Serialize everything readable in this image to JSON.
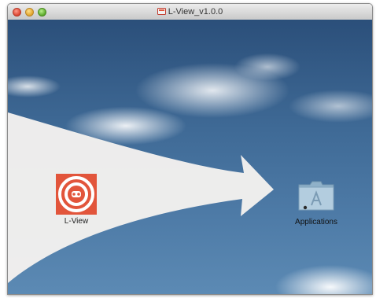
{
  "window": {
    "title": "L-View_v1.0.0"
  },
  "icons": {
    "title_icon": "disk-image-icon",
    "app_icon": "l-view-app-icon",
    "folder_icon": "applications-folder-icon",
    "arrow": "drag-arrow"
  },
  "items": {
    "app_label": "L-View",
    "folder_label": "Applications"
  },
  "colors": {
    "app_icon_bg": "#e2553b",
    "sky_top": "#2b4f7a",
    "sky_bottom": "#5c8ab4",
    "folder": "#a9c3d6"
  }
}
